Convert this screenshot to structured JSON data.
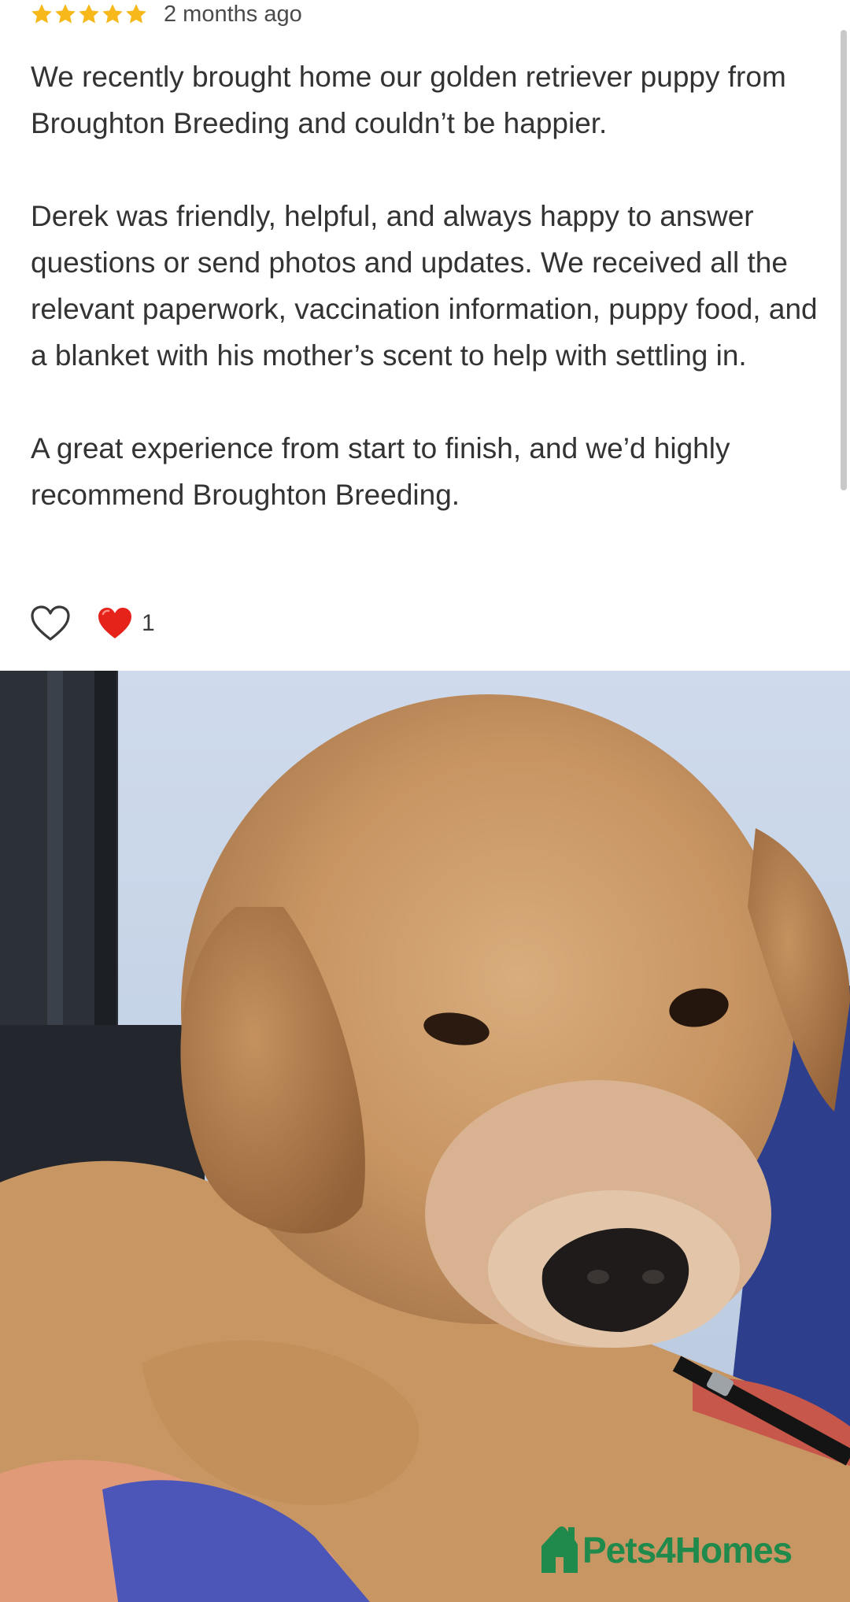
{
  "review": {
    "rating": 5,
    "rating_max": 5,
    "star_color": "#f6b81b",
    "time": "2 months ago",
    "paragraphs": [
      "We recently brought home our golden retriever puppy from Broughton Breeding and couldn’t be happier.",
      "Derek was friendly, helpful, and always happy to answer questions or send photos and updates. We received all the relevant paperwork, vaccination information, puppy food, and a blanket with his mother’s scent to help with settling in.",
      "A great experience from start to finish, and we’d highly recommend Broughton Breeding."
    ],
    "reactions": {
      "like_icon": "heart-outline-icon",
      "reaction_icon": "red-heart-icon",
      "count": "1"
    }
  },
  "photo": {
    "subject": "golden-retriever-puppy",
    "watermark": "Pets4Homes",
    "watermark_color": "#1f8a4c"
  }
}
